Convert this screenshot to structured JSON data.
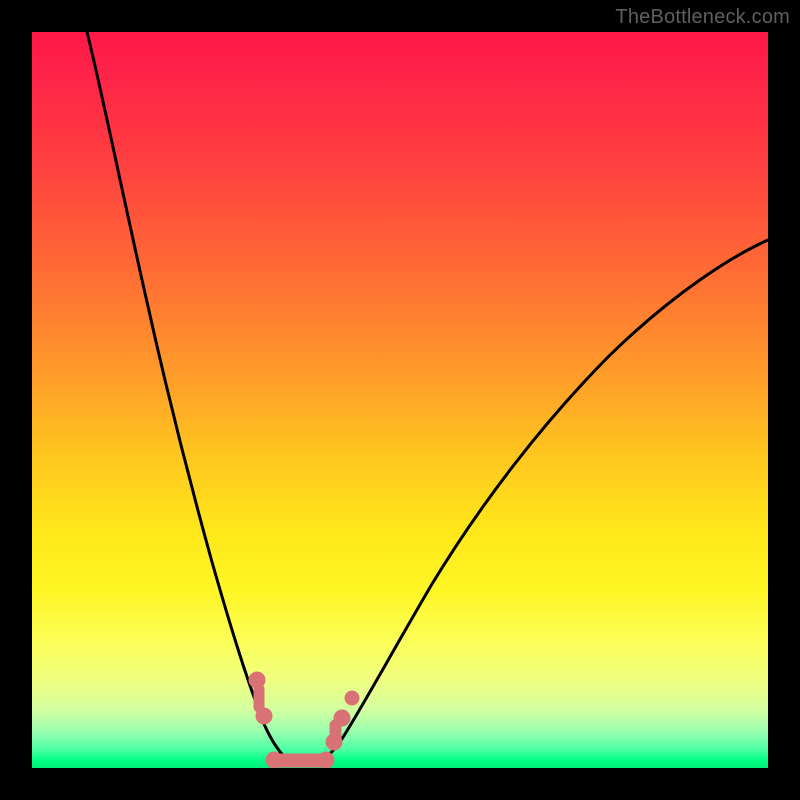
{
  "watermark": "TheBottleneck.com",
  "colors": {
    "frame": "#000000",
    "curve": "#000000",
    "markers": "#d97275",
    "gradient_top": "#ff1848",
    "gradient_bottom": "#00ee78"
  },
  "chart_data": {
    "type": "line",
    "title": "",
    "xlabel": "",
    "ylabel": "",
    "xlim": [
      0,
      100
    ],
    "ylim": [
      0,
      100
    ],
    "note": "V-shaped bottleneck curve. Two branches drop to ~0% near x≈34 and rise toward edges. Values read off the vertical gradient where 0=bottom(green)=best and 100=top(red)=worst.",
    "series": [
      {
        "name": "left-branch",
        "x": [
          7,
          10,
          13,
          16,
          19,
          22,
          25,
          28,
          30,
          31,
          32,
          33,
          34,
          35,
          36,
          37
        ],
        "values": [
          100,
          92,
          83,
          74,
          64,
          53,
          42,
          30,
          21,
          16,
          12,
          8,
          4,
          2,
          1,
          0
        ]
      },
      {
        "name": "right-branch",
        "x": [
          37,
          39,
          41,
          44,
          48,
          53,
          58,
          64,
          70,
          76,
          82,
          88,
          94,
          100
        ],
        "values": [
          0,
          3,
          6,
          11,
          18,
          26,
          33,
          40,
          47,
          53,
          58,
          63,
          67,
          71
        ]
      }
    ],
    "markers": {
      "name": "trough-markers",
      "shape": "circle",
      "color": "#d97275",
      "note": "Salmon dots/segments clustered at the valley, roughly y≈0–12 on both sides of the trough.",
      "x": [
        30.5,
        31.5,
        33,
        35,
        37,
        38.5,
        40,
        41
      ],
      "values": [
        12,
        9,
        3,
        0,
        0,
        2,
        6,
        9
      ]
    }
  }
}
